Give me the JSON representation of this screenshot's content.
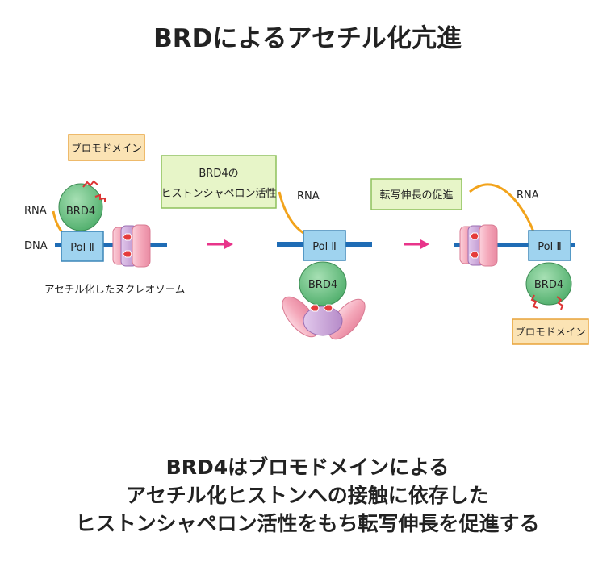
{
  "title": "BRDによるアセチル化亢進",
  "panels": {
    "panel1": {
      "domain_label": "ブロモドメイン",
      "rna": "RNA",
      "dna": "DNA",
      "pol": "Pol Ⅱ",
      "brd4": "BRD4",
      "nucleosome_label": "アセチル化したヌクレオソーム"
    },
    "panel2": {
      "box_line1": "BRD4の",
      "box_line2": "ヒストンシャペロン活性",
      "rna": "RNA",
      "pol": "Pol Ⅱ",
      "brd4": "BRD4"
    },
    "panel3": {
      "box_label": "転写伸長の促進",
      "rna": "RNA",
      "pol": "Pol Ⅱ",
      "brd4": "BRD4",
      "domain_label": "ブロモドメイン"
    }
  },
  "caption": {
    "line1": "BRD4はブロモドメインによる",
    "line2": "アセチル化ヒストンへの接触に依存した",
    "line3": "ヒストンシャペロン活性をもち転写伸長を促進する"
  },
  "colors": {
    "dna": "#1f6cb5",
    "pol_fill": "#9fd3ef",
    "brd4_fill": "#6cc486",
    "orange_box": "#fbe3b4",
    "green_box": "#e7f5c8",
    "histone_pink": "#f4a7b9",
    "histone_purple": "#c39ad3",
    "acetyl_red": "#e53b3b",
    "arrow": "#e8348a",
    "rna": "#f2a31b"
  }
}
